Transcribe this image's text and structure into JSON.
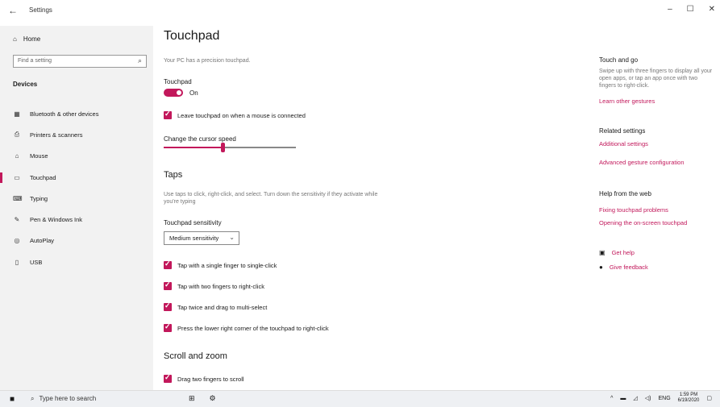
{
  "window": {
    "title": "Settings",
    "back_icon": "←",
    "minimize": "–",
    "maximize": "☐",
    "close": "✕"
  },
  "sidebar": {
    "home_label": "Home",
    "search_placeholder": "Find a setting",
    "section_title": "Devices",
    "items": [
      {
        "label": "Bluetooth & other devices",
        "icon": "bluetooth-icon",
        "glyph": "▦"
      },
      {
        "label": "Printers & scanners",
        "icon": "printer-icon",
        "glyph": "⎙"
      },
      {
        "label": "Mouse",
        "icon": "mouse-icon",
        "glyph": "⌂"
      },
      {
        "label": "Touchpad",
        "icon": "touchpad-icon",
        "glyph": "▭"
      },
      {
        "label": "Typing",
        "icon": "keyboard-icon",
        "glyph": "⌨"
      },
      {
        "label": "Pen & Windows Ink",
        "icon": "pen-icon",
        "glyph": "✎"
      },
      {
        "label": "AutoPlay",
        "icon": "autoplay-icon",
        "glyph": "◎"
      },
      {
        "label": "USB",
        "icon": "usb-icon",
        "glyph": "▯"
      }
    ]
  },
  "main": {
    "title": "Touchpad",
    "subtitle": "Your PC has a precision touchpad.",
    "touchpad_label": "Touchpad",
    "toggle_state": "On",
    "leave_on_label": "Leave touchpad on when a mouse is connected",
    "cursor_speed_label": "Change the cursor speed",
    "cursor_speed_value": 0.45,
    "taps_heading": "Taps",
    "taps_desc": "Use taps to click, right-click, and select. Turn down the sensitivity if they activate while you're typing",
    "sensitivity_label": "Touchpad sensitivity",
    "sensitivity_value": "Medium sensitivity",
    "tap_options": [
      "Tap with a single finger to single-click",
      "Tap with two fingers to right-click",
      "Tap twice and drag to multi-select",
      "Press the lower right corner of the touchpad to right-click"
    ],
    "scroll_heading": "Scroll and zoom",
    "scroll_option": "Drag two fingers to scroll"
  },
  "right": {
    "touch_heading": "Touch and go",
    "touch_text": "Swipe up with three fingers to display all your open apps, or tap an app once with two fingers to right-click.",
    "learn_link": "Learn other gestures",
    "related_heading": "Related settings",
    "additional_link": "Additional settings",
    "advanced_link": "Advanced gesture configuration",
    "help_heading": "Help from the web",
    "help_links": [
      "Fixing touchpad problems",
      "Opening the on-screen touchpad"
    ],
    "get_help": "Get help",
    "feedback": "Give feedback"
  },
  "taskbar": {
    "search_text": "Type here to search",
    "lang": "ENG",
    "time": "1:59 PM",
    "date": "6/19/2020"
  },
  "colors": {
    "accent": "#c2185b"
  }
}
